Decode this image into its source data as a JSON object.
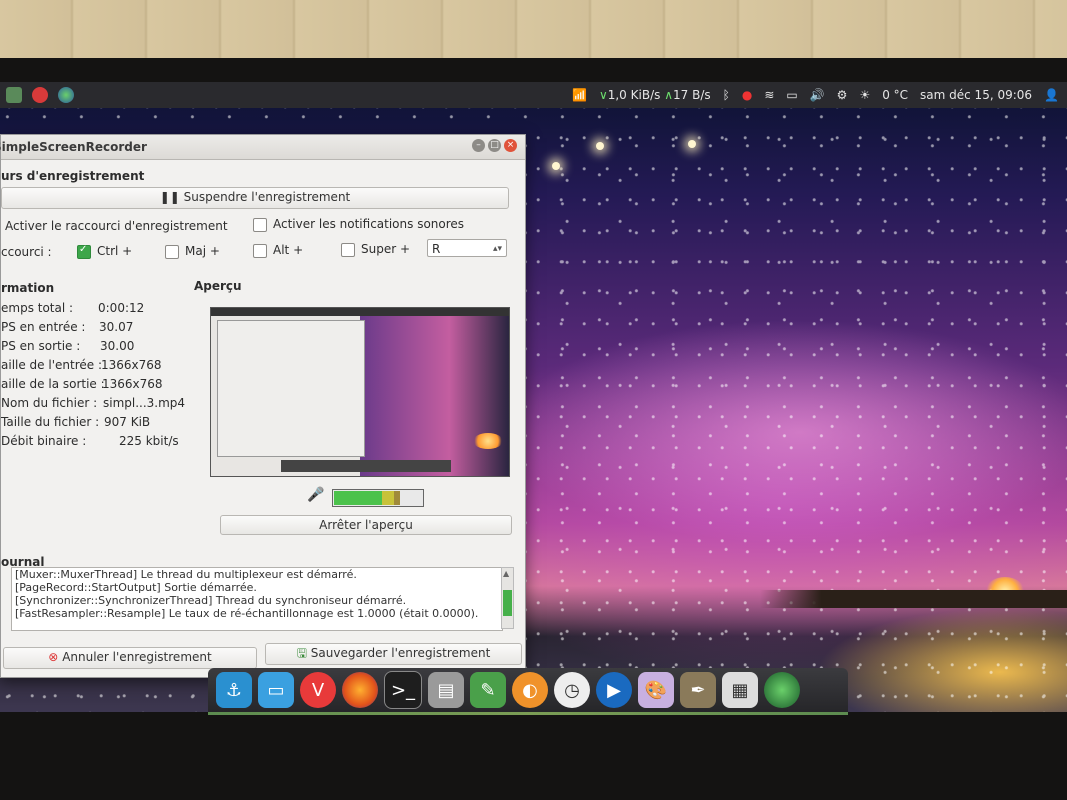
{
  "panel": {
    "net_down": "1,0 KiB/s",
    "net_up": "17 B/s",
    "weather": "0 °C",
    "clock": "sam déc 15, 09:06"
  },
  "window": {
    "title": "SimpleScreenRecorder",
    "recording_section": "urs d'enregistrement",
    "pause_button": "Suspendre l'enregistrement",
    "enable_hotkey": "Activer le raccourci d'enregistrement",
    "enable_sound": "Activer les notifications sonores",
    "hotkey_label": "ccourci :",
    "mod_ctrl": "Ctrl +",
    "mod_shift": "Maj +",
    "mod_alt": "Alt +",
    "mod_super": "Super +",
    "hotkey_key": "R",
    "info_title": "rmation",
    "preview_title": "Aperçu",
    "info": [
      {
        "label": "emps total :",
        "value": "0:00:12"
      },
      {
        "label": "PS en entrée :",
        "value": "30.07"
      },
      {
        "label": "PS en sortie :",
        "value": "30.00"
      },
      {
        "label": "aille de l'entrée :",
        "value": "1366x768"
      },
      {
        "label": "aille de la sortie :",
        "value": "1366x768"
      },
      {
        "label": "Nom du fichier :",
        "value": "simpl...3.mp4"
      },
      {
        "label": "Taille du fichier :",
        "value": "907 KiB"
      },
      {
        "label": "Débit binaire :",
        "value": "225 kbit/s"
      }
    ],
    "stop_preview_button": "Arrêter l'aperçu",
    "journal_title": "ournal",
    "journal_lines": [
      "[Muxer::MuxerThread] Le thread du multiplexeur est démarré.",
      "[PageRecord::StartOutput] Sortie démarrée.",
      "[Synchronizer::SynchronizerThread] Thread du synchroniseur démarré.",
      "[FastResampler::Resample] Le taux de ré-échantillonnage est 1.0000 (était 0.0000)."
    ],
    "cancel_button": "Annuler l'enregistrement",
    "save_button": "Sauvegarder l'enregistrement"
  },
  "colors": {
    "accent_green": "#3da64a",
    "panel_bg": "#2a2a2e",
    "close_red": "#e0533a"
  }
}
